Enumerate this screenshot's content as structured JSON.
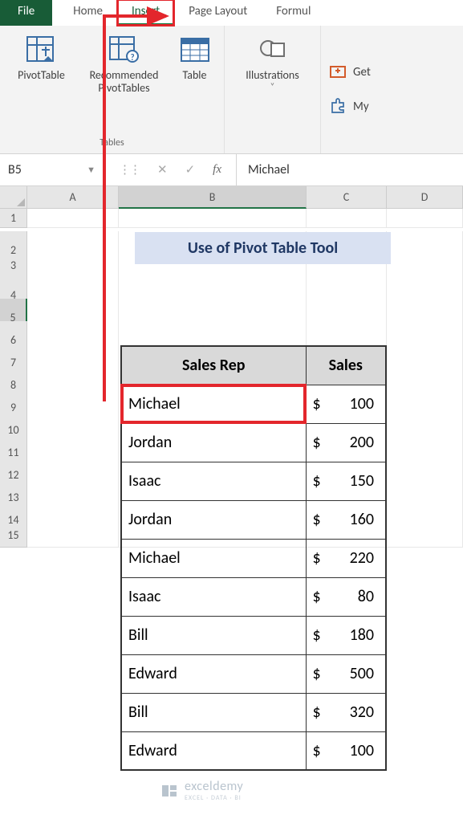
{
  "tabs": {
    "file": "File",
    "items": [
      "Home",
      "Insert",
      "Page Layout",
      "Formul"
    ],
    "active_index": 1
  },
  "ribbon": {
    "tables_group": {
      "label": "Tables",
      "pivot": "PivotTable",
      "recommended_line1": "Recommended",
      "recommended_line2": "PivotTables",
      "table": "Table"
    },
    "illustrations": {
      "label": "Illustrations"
    },
    "side": {
      "get": "Get",
      "my": "My "
    }
  },
  "formulabar": {
    "namebox": "B5",
    "fx": "fx",
    "content": "Michael"
  },
  "columns": [
    "A",
    "B",
    "C",
    "D"
  ],
  "rows": [
    "1",
    "2",
    "3",
    "4",
    "5",
    "6",
    "7",
    "8",
    "9",
    "10",
    "11",
    "12",
    "13",
    "14",
    "15"
  ],
  "selected_col_index": 1,
  "selected_row_index": 4,
  "title": "Use of Pivot Table Tool",
  "table": {
    "headers": {
      "rep": "Sales Rep",
      "sales": "Sales"
    },
    "currency": "$",
    "rows": [
      {
        "rep": "Michael",
        "sales": 100
      },
      {
        "rep": "Jordan",
        "sales": 200
      },
      {
        "rep": "Isaac",
        "sales": 150
      },
      {
        "rep": "Jordan",
        "sales": 160
      },
      {
        "rep": "Michael",
        "sales": 220
      },
      {
        "rep": "Isaac",
        "sales": 80
      },
      {
        "rep": "Bill",
        "sales": 180
      },
      {
        "rep": "Edward",
        "sales": 500
      },
      {
        "rep": "Bill",
        "sales": 320
      },
      {
        "rep": "Edward",
        "sales": 100
      }
    ],
    "highlight_row_index": 0
  },
  "watermark": {
    "brand": "exceldemy",
    "tag": "EXCEL · DATA · BI"
  }
}
